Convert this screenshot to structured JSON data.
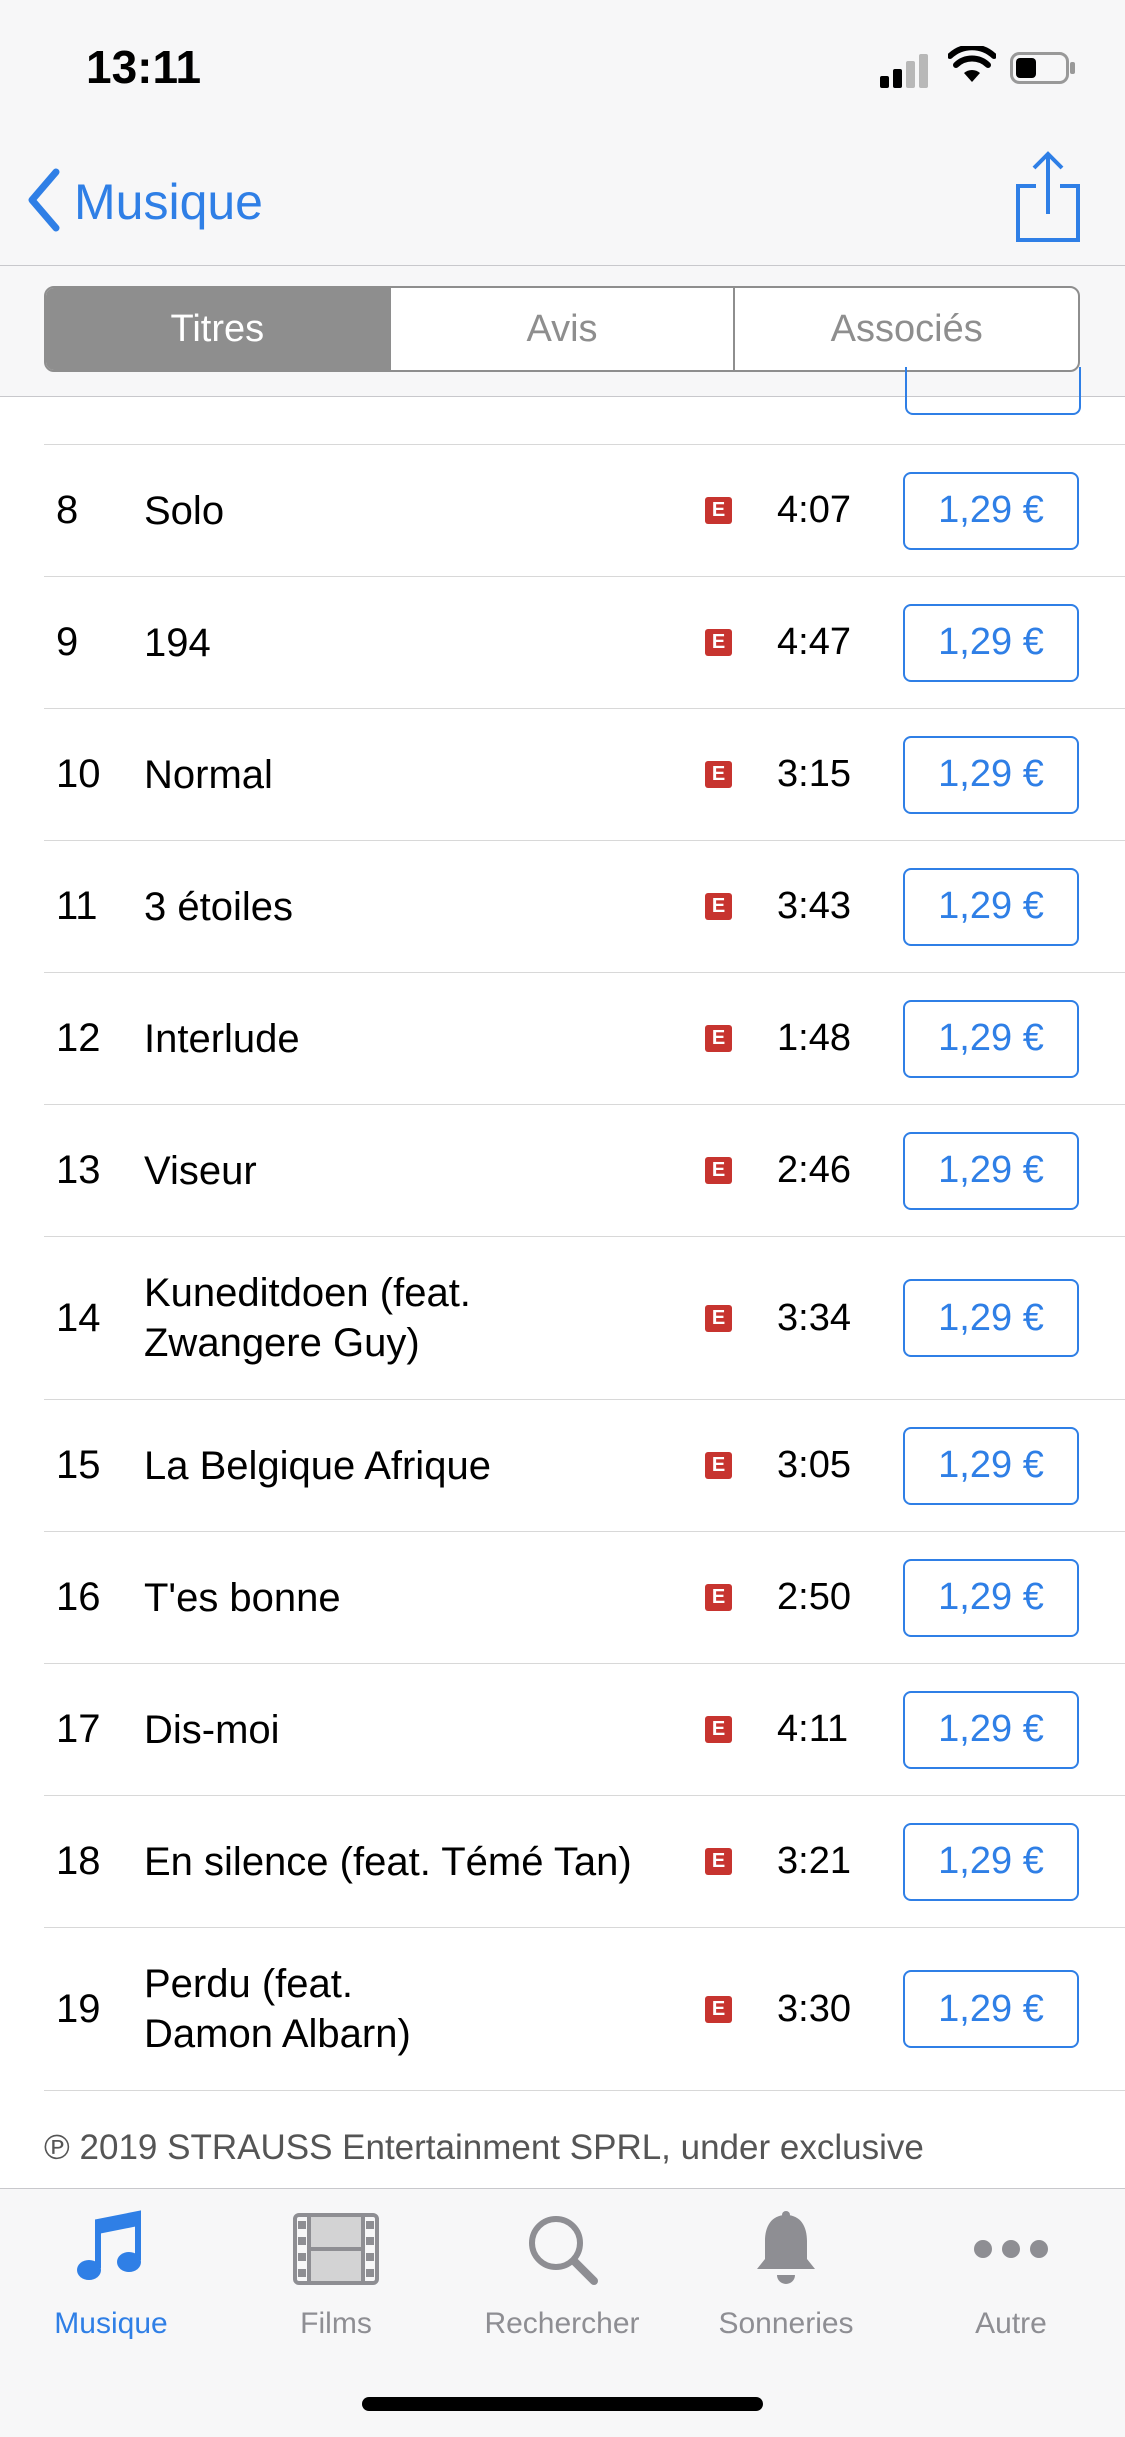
{
  "status": {
    "time": "13:11"
  },
  "nav": {
    "back_label": "Musique"
  },
  "segments": [
    {
      "label": "Titres",
      "active": true
    },
    {
      "label": "Avis",
      "active": false
    },
    {
      "label": "Associés",
      "active": false
    }
  ],
  "tracks": [
    {
      "num": "8",
      "title": "Solo",
      "explicit": "E",
      "duration": "4:07",
      "price": "1,29 €"
    },
    {
      "num": "9",
      "title": "194",
      "explicit": "E",
      "duration": "4:47",
      "price": "1,29 €"
    },
    {
      "num": "10",
      "title": "Normal",
      "explicit": "E",
      "duration": "3:15",
      "price": "1,29 €"
    },
    {
      "num": "11",
      "title": "3 étoiles",
      "explicit": "E",
      "duration": "3:43",
      "price": "1,29 €"
    },
    {
      "num": "12",
      "title": "Interlude",
      "explicit": "E",
      "duration": "1:48",
      "price": "1,29 €"
    },
    {
      "num": "13",
      "title": "Viseur",
      "explicit": "E",
      "duration": "2:46",
      "price": "1,29 €"
    },
    {
      "num": "14",
      "title": "Kuneditdoen (feat.\nZwangere Guy)",
      "explicit": "E",
      "duration": "3:34",
      "price": "1,29 €"
    },
    {
      "num": "15",
      "title": "La Belgique Afrique",
      "explicit": "E",
      "duration": "3:05",
      "price": "1,29 €"
    },
    {
      "num": "16",
      "title": "T'es bonne",
      "explicit": "E",
      "duration": "2:50",
      "price": "1,29 €"
    },
    {
      "num": "17",
      "title": "Dis-moi",
      "explicit": "E",
      "duration": "4:11",
      "price": "1,29 €"
    },
    {
      "num": "18",
      "title": "En silence (feat. Témé Tan)",
      "explicit": "E",
      "duration": "3:21",
      "price": "1,29 €"
    },
    {
      "num": "19",
      "title": "Perdu (feat.\nDamon Albarn)",
      "explicit": "E",
      "duration": "3:30",
      "price": "1,29 €"
    }
  ],
  "copyright": "℗ 2019 STRAUSS Entertainment SPRL, under exclusive",
  "tabs": [
    {
      "label": "Musique",
      "icon": "music-note-icon",
      "active": true
    },
    {
      "label": "Films",
      "icon": "film-icon",
      "active": false
    },
    {
      "label": "Rechercher",
      "icon": "search-icon",
      "active": false
    },
    {
      "label": "Sonneries",
      "icon": "bell-icon",
      "active": false
    },
    {
      "label": "Autre",
      "icon": "more-icon",
      "active": false
    }
  ],
  "colors": {
    "accent": "#2f7fe6",
    "explicit": "#c7342f",
    "inactive": "#8e8e93"
  }
}
